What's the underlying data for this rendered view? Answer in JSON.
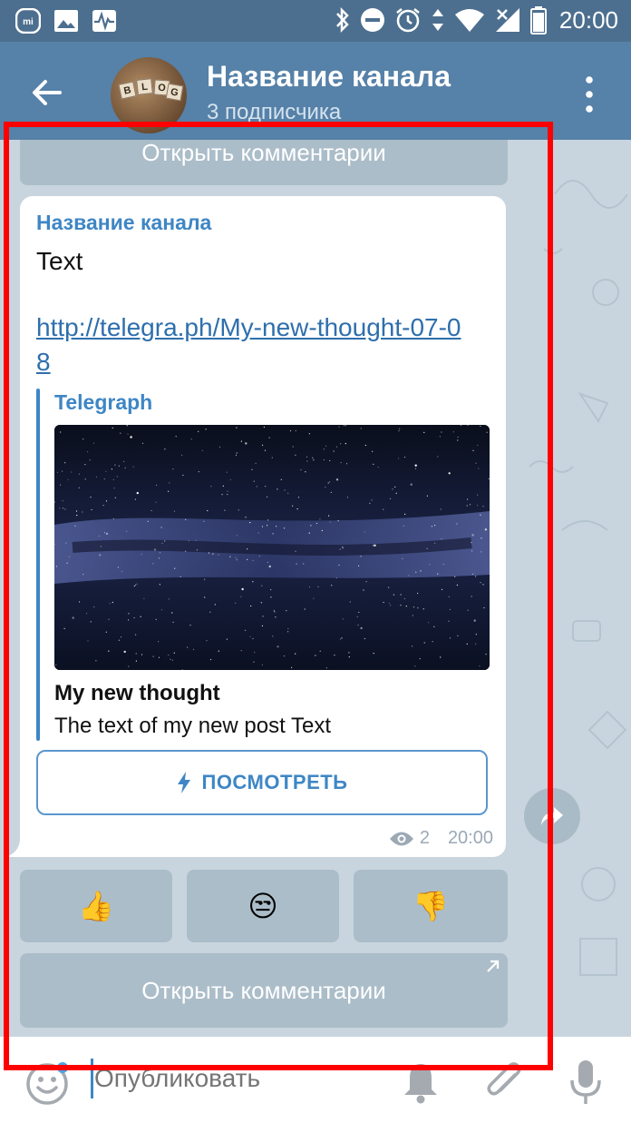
{
  "status_bar": {
    "time": "20:00",
    "left_icons": [
      "mi-icon",
      "gallery-icon",
      "activity-icon"
    ],
    "right_icons": [
      "bluetooth-icon",
      "do-not-disturb-icon",
      "alarm-icon",
      "data-arrows-icon",
      "wifi-icon",
      "no-signal-icon",
      "battery-icon"
    ]
  },
  "app_bar": {
    "channel_title": "Название канала",
    "subscribers": "3 подписчика",
    "avatar_letters": [
      "B",
      "L",
      "O",
      "G"
    ]
  },
  "top_button": {
    "label": "Открыть комментарии"
  },
  "message": {
    "channel_name": "Название канала",
    "text": "Text",
    "link": "http://telegra.ph/My-new-thought-07-08",
    "preview": {
      "site_name": "Telegraph",
      "title": "My new thought",
      "description": "The text of my new post Text",
      "image": "milky-way-night-sky"
    },
    "view_button": "ПОСМОТРЕТЬ",
    "views": "2",
    "time": "20:00"
  },
  "reactions": [
    {
      "emoji": "👍",
      "name": "thumbs-up"
    },
    {
      "emoji": "😒",
      "name": "unamused-face"
    },
    {
      "emoji": "👎",
      "name": "thumbs-down"
    }
  ],
  "bottom_button": {
    "label": "Открыть комментарии"
  },
  "input": {
    "placeholder": "Опубликовать"
  },
  "colors": {
    "header": "#5681a8",
    "status_bar": "#4d6f8f",
    "accent": "#3e86c5",
    "highlight": "#ff0000"
  }
}
